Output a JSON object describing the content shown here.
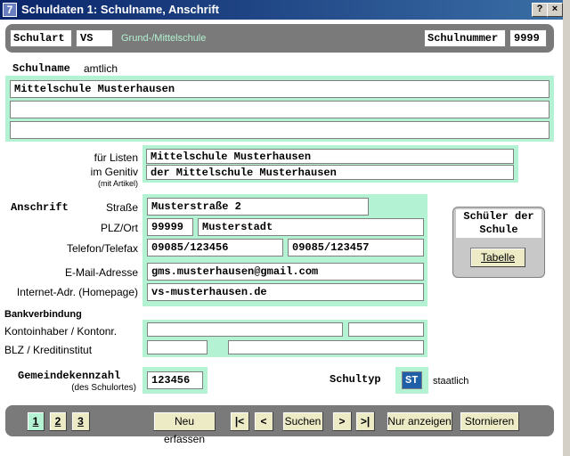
{
  "window": {
    "title": "Schuldaten 1:  Schulname, Anschrift",
    "help": "?",
    "close": "×",
    "app_icon": "7"
  },
  "header": {
    "schulart_label": "Schulart",
    "schulart_value": "VS",
    "schulart_desc": "Grund-/Mittelschule",
    "schulnummer_label": "Schulnummer",
    "schulnummer_value": "9999"
  },
  "schulname": {
    "label": "Schulname",
    "sublabel": "amtlich",
    "line1": "Mittelschule Musterhausen",
    "line2": "",
    "line3": ""
  },
  "listen": {
    "label1": "für Listen",
    "label2": "im Genitiv",
    "label3": "(mit Artikel)",
    "value1": "Mittelschule Musterhausen",
    "value2": "der Mittelschule Musterhausen"
  },
  "anschrift": {
    "label": "Anschrift",
    "strasse_label": "Straße",
    "strasse": "Musterstraße 2",
    "plzort_label": "PLZ/Ort",
    "plz": "99999",
    "ort": "Musterstadt",
    "telefon_label": "Telefon/Telefax",
    "telefon": "09085/123456",
    "telefax": "09085/123457",
    "email_label": "E-Mail-Adresse",
    "email": "gms.musterhausen@gmail.com",
    "internet_label": "Internet-Adr. (Homepage)",
    "internet": "vs-musterhausen.de"
  },
  "schueler": {
    "title": "Schüler der Schule",
    "button": "Tabelle"
  },
  "bank": {
    "label": "Bankverbindung",
    "kontoinhaber_label": "Kontoinhaber / Kontonr.",
    "blz_label": "BLZ / Kreditinstitut"
  },
  "gemeinde": {
    "label": "Gemeindekennzahl",
    "sublabel": "(des Schulortes)",
    "value": "123456"
  },
  "schultyp": {
    "label": "Schultyp",
    "value": "ST",
    "desc": "staatlich"
  },
  "footer": {
    "pages": [
      "1",
      "2",
      "3"
    ],
    "neu": "Neu erfassen",
    "first": "|<",
    "prev": "<",
    "suchen": "Suchen",
    "next": ">",
    "last": ">|",
    "nur_anzeigen": "Nur anzeigen",
    "stornieren": "Stornieren"
  }
}
